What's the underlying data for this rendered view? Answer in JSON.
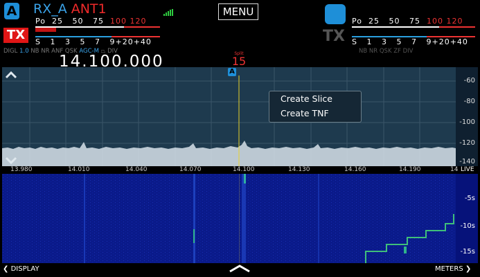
{
  "left_panel": {
    "slice_letter": "A",
    "rx_name": "RX_A",
    "antenna": "ANT1",
    "tx_label": "TX",
    "meter_labels_top": [
      "Po",
      "25",
      "50",
      "75"
    ],
    "meter_labels_top_red": [
      "100",
      "120"
    ],
    "meter_labels_bottom": [
      "S",
      "1",
      "3",
      "5",
      "7",
      "9"
    ],
    "meter_labels_bottom_red": [
      "+20",
      "+40"
    ],
    "mode": "DIGL",
    "mode_value": "1.0",
    "flags_dim": "NB NR ANF QSK",
    "flag_agc": "AGC-M",
    "flags_dim2": "DIV",
    "frequency": "14.100.000"
  },
  "menu": {
    "label": "MENU"
  },
  "right_panel": {
    "tx_label": "TX",
    "meter_labels_top": [
      "Po",
      "25",
      "50",
      "75"
    ],
    "meter_labels_top_red": [
      "100",
      "120"
    ],
    "meter_labels_bottom": [
      "S",
      "1",
      "3",
      "5",
      "7",
      "9"
    ],
    "meter_labels_bottom_red": [
      "+20",
      "+40"
    ],
    "flags": "NB NR  QSK  ZF DIV"
  },
  "center_marker": {
    "label": "Split",
    "value": "15"
  },
  "spectrum": {
    "slice_marker": "A",
    "db_labels": [
      "-60",
      "-80",
      "-100",
      "-120",
      "-140"
    ]
  },
  "freq_axis": {
    "labels": [
      "13.980",
      "14.010",
      "14.040",
      "14.070",
      "14.100",
      "14.130",
      "14.160",
      "14.190",
      "14"
    ],
    "live": "LIVE"
  },
  "waterfall": {
    "time_labels": [
      "-5s",
      "-10s",
      "-15s"
    ]
  },
  "context_menu": {
    "items": [
      "Create Slice",
      "Create TNF"
    ]
  },
  "bottom_bar": {
    "left": "DISPLAY",
    "right": "METERS"
  },
  "colors": {
    "accent_blue": "#1e8fd8",
    "tx_red": "#e01616",
    "waterfall_blue": "#0a1a8a",
    "spectrum_bg": "#1e3a4e"
  }
}
